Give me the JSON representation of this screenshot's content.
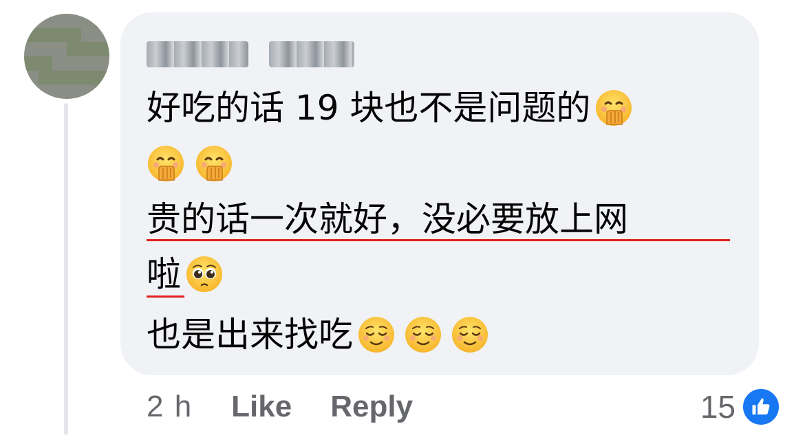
{
  "comment": {
    "author_name_redacted": true,
    "lines": [
      {
        "text": "好吃的话 19 块也不是问题的",
        "emojis": [
          "hand-over-mouth"
        ]
      },
      {
        "text": "",
        "emojis": [
          "hand-over-mouth",
          "hand-over-mouth"
        ]
      },
      {
        "text": "贵的话一次就好，没必要放上网",
        "emojis": []
      },
      {
        "text": "啦",
        "emojis": [
          "pleading-face"
        ]
      },
      {
        "text": "也是出来找吃",
        "emojis": [
          "relieved-face",
          "relieved-face",
          "relieved-face"
        ]
      }
    ]
  },
  "actions": {
    "time": "2 h",
    "like_label": "Like",
    "reply_label": "Reply"
  },
  "reactions": {
    "count": "15",
    "icon": "thumbs-up-icon",
    "color": "#1877f2"
  },
  "colors": {
    "bubble": "#f0f2f5",
    "text": "#050505",
    "meta": "#65676b",
    "spellcheck_underline": "#e0201e"
  }
}
